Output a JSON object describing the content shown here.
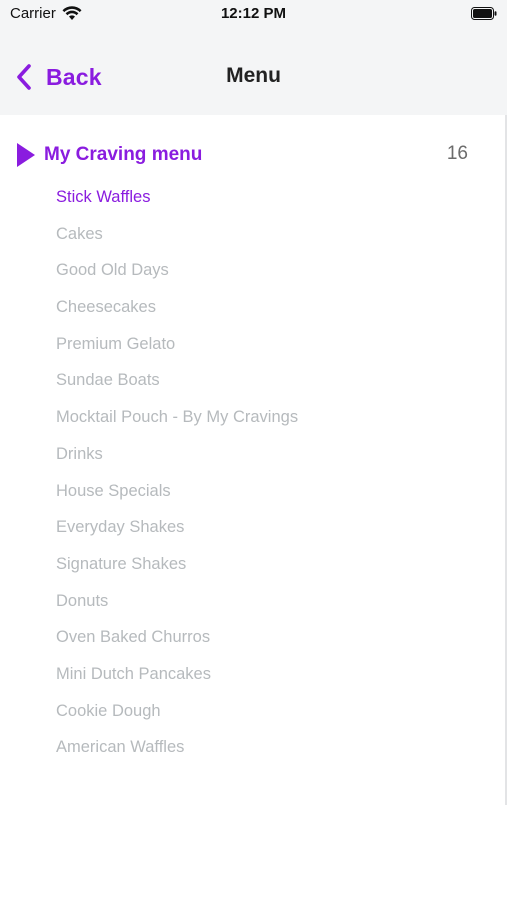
{
  "status_bar": {
    "carrier": "Carrier",
    "time": "12:12 PM",
    "wifi_icon": "wifi-icon",
    "battery_icon": "battery-icon"
  },
  "nav": {
    "back_label": "Back",
    "back_icon": "chevron-left-icon",
    "title": "Menu"
  },
  "menu_section": {
    "title": "My Craving menu",
    "count": "16",
    "icon": "triangle-right-icon",
    "active_index": 0,
    "items": [
      {
        "label": "Stick Waffles"
      },
      {
        "label": "Cakes"
      },
      {
        "label": "Good Old Days"
      },
      {
        "label": "Cheesecakes"
      },
      {
        "label": "Premium Gelato"
      },
      {
        "label": "Sundae Boats"
      },
      {
        "label": "Mocktail Pouch - By My Cravings"
      },
      {
        "label": "Drinks"
      },
      {
        "label": "House Specials"
      },
      {
        "label": "Everyday Shakes"
      },
      {
        "label": "Signature Shakes"
      },
      {
        "label": "Donuts"
      },
      {
        "label": "Oven Baked Churros"
      },
      {
        "label": "Mini Dutch Pancakes"
      },
      {
        "label": "Cookie Dough"
      },
      {
        "label": "American Waffles"
      }
    ]
  },
  "colors": {
    "accent": "#8a1cdf",
    "inactive_text": "#b6babd",
    "bar_background": "#f4f5f6"
  }
}
